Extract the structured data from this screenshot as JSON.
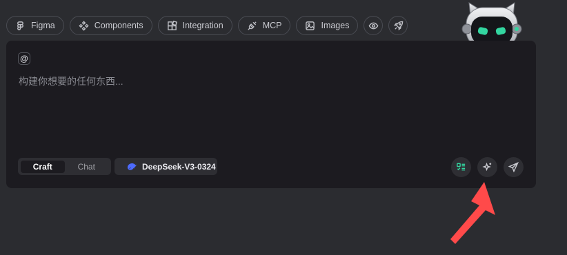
{
  "toolbar": {
    "chips": [
      {
        "label": "Figma",
        "icon": "figma-icon"
      },
      {
        "label": "Components",
        "icon": "components-icon"
      },
      {
        "label": "Integration",
        "icon": "integration-icon"
      },
      {
        "label": "MCP",
        "icon": "plug-icon"
      },
      {
        "label": "Images",
        "icon": "image-icon"
      }
    ],
    "preview_icon": "eye-icon",
    "deploy_icon": "rocket-icon"
  },
  "composer": {
    "mention_symbol": "@",
    "placeholder": "构建你想要的任何东西...",
    "modes": [
      "Craft",
      "Chat"
    ],
    "active_mode": "Craft",
    "model": "DeepSeek-V3-0324"
  },
  "colors": {
    "background": "#2b2c30",
    "panel": "#1c1b20",
    "accent_green": "#33d6a0",
    "deepseek_blue": "#4d6bfe",
    "annotation_arrow": "#ff4a4a"
  }
}
